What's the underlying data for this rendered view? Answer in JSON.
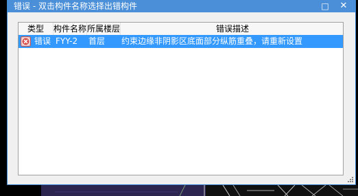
{
  "window": {
    "title": "错误 - 双击构件名称选择出错构件",
    "minimize_glyph": "□",
    "close_glyph": "✕"
  },
  "table": {
    "columns": [
      "类型",
      "构件名称",
      "所属楼层",
      "错误描述"
    ],
    "rows": [
      {
        "icon": "error-x-icon",
        "type": "错误",
        "name": "FYY-2",
        "floor": "首层",
        "description": "约束边缘非阴影区底面部分纵筋重叠，请重新设置"
      }
    ]
  },
  "colors": {
    "titlebar": "#4a8fd8",
    "selection": "#3399ff",
    "dialog_bg": "#f0f0f0",
    "error_icon": "#c0504d"
  }
}
